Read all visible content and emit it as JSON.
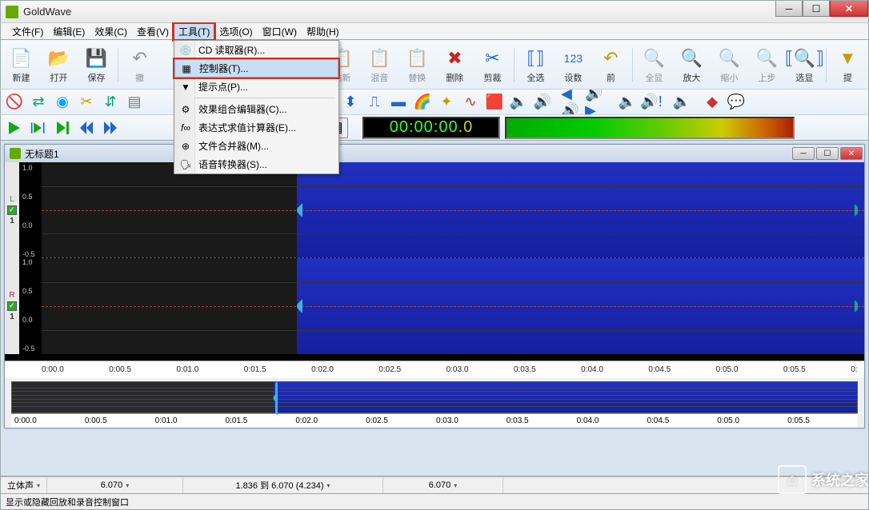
{
  "app_title": "GoldWave",
  "menubar": {
    "file": "文件(F)",
    "edit": "编辑(E)",
    "effects": "效果(C)",
    "view": "查看(V)",
    "tools": "工具(T)",
    "options": "选项(O)",
    "window": "窗口(W)",
    "help": "帮助(H)"
  },
  "tools_menu": {
    "cd_reader": "CD 读取器(R)...",
    "controller": "控制器(T)...",
    "cue_points": "提示点(P)...",
    "effect_chain": "效果组合编辑器(C)...",
    "expression": "表达式求值计算器(E)...",
    "file_merger": "文件合并器(M)...",
    "speech": "语音转换器(S)..."
  },
  "toolbar_labels": {
    "new": "新建",
    "open": "打开",
    "save": "保存",
    "undo": "撤",
    "paste_new": "粘新",
    "mix": "混音",
    "replace": "替换",
    "delete": "删除",
    "trim": "剪裁",
    "select_all": "全选",
    "set": "设数",
    "prev": "前",
    "all": "全显",
    "zoom_in": "放大",
    "zoom_out": "缩小",
    "step_up": "上步",
    "sel_zoom": "选显",
    "hint": "提"
  },
  "timer": {
    "hh": "00",
    "mm": "00",
    "ss": "00",
    "frac": ".0"
  },
  "document": {
    "title": "无标题1",
    "amp_labels_l": [
      "1.0",
      "0.5",
      "0.0",
      "-0.5"
    ],
    "amp_labels_r": [
      "1.0",
      "0.5",
      "0.0",
      "-0.5"
    ],
    "time_labels": [
      "0:00.0",
      "0:00.5",
      "0:01.0",
      "0:01.5",
      "0:02.0",
      "0:02.5",
      "0:03.0",
      "0:03.5",
      "0:04.0",
      "0:04.5",
      "0:05.0",
      "0:05.5",
      "0:"
    ],
    "mini_time_labels": [
      "0:00.0",
      "0:00.5",
      "0:01.0",
      "0:01.5",
      "0:02.0",
      "0:02.5",
      "0:03.0",
      "0:03.5",
      "0:04.0",
      "0:04.5",
      "0:05.0",
      "0:05.5"
    ]
  },
  "statusbar": {
    "mode": "立体声",
    "length": "6.070",
    "selection": "1.836 到 6.070 (4.234)",
    "length2": "6.070"
  },
  "statusbar2_text": "显示或隐藏回放和录音控制窗口",
  "watermark_text": "系统之家"
}
